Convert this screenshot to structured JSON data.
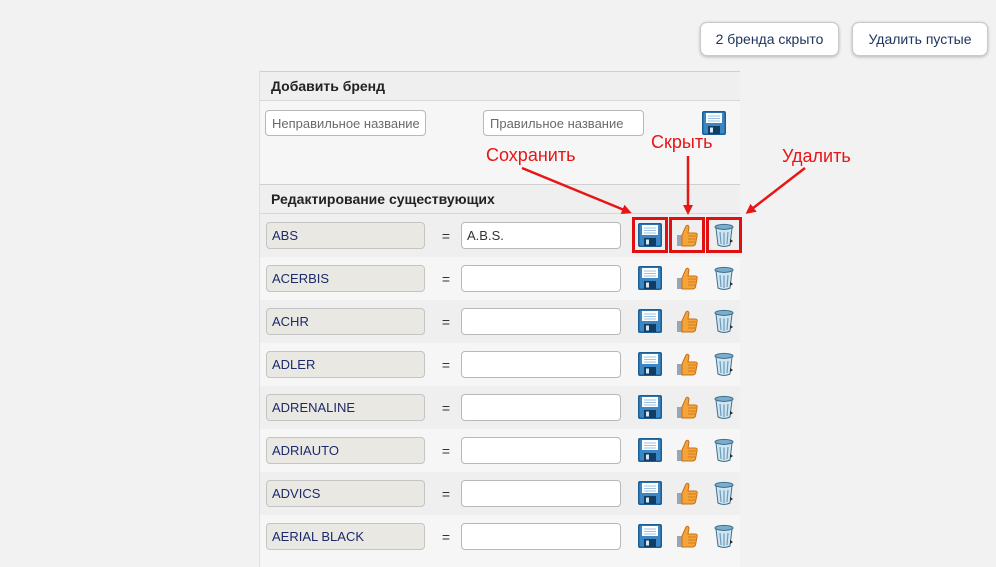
{
  "toolbar": {
    "hidden_brands_label": "2 бренда скрыто",
    "delete_empty_label": "Удалить пустые"
  },
  "add_section": {
    "title": "Добавить бренд",
    "wrong_name_placeholder": "Неправильное название",
    "right_name_placeholder": "Правильное название"
  },
  "edit_section": {
    "title": "Редактирование существующих",
    "equals": "=",
    "rows": [
      {
        "brand": "ABS",
        "alias": "A.B.S."
      },
      {
        "brand": "ACERBIS",
        "alias": ""
      },
      {
        "brand": "ACHR",
        "alias": ""
      },
      {
        "brand": "ADLER",
        "alias": ""
      },
      {
        "brand": "ADRENALINE",
        "alias": ""
      },
      {
        "brand": "ADRIAUTO",
        "alias": ""
      },
      {
        "brand": "ADVICS",
        "alias": ""
      },
      {
        "brand": "AERIAL BLACK",
        "alias": ""
      }
    ]
  },
  "annotations": {
    "save": "Сохранить",
    "hide": "Скрыть",
    "delete": "Удалить"
  },
  "icons": {
    "save": "floppy-disk-icon",
    "hide": "thumbs-up-icon",
    "delete": "trash-can-icon"
  },
  "colors": {
    "annotation": "#e81515",
    "brand_text": "#1c2a6b",
    "floppy": "#1c5f96"
  }
}
